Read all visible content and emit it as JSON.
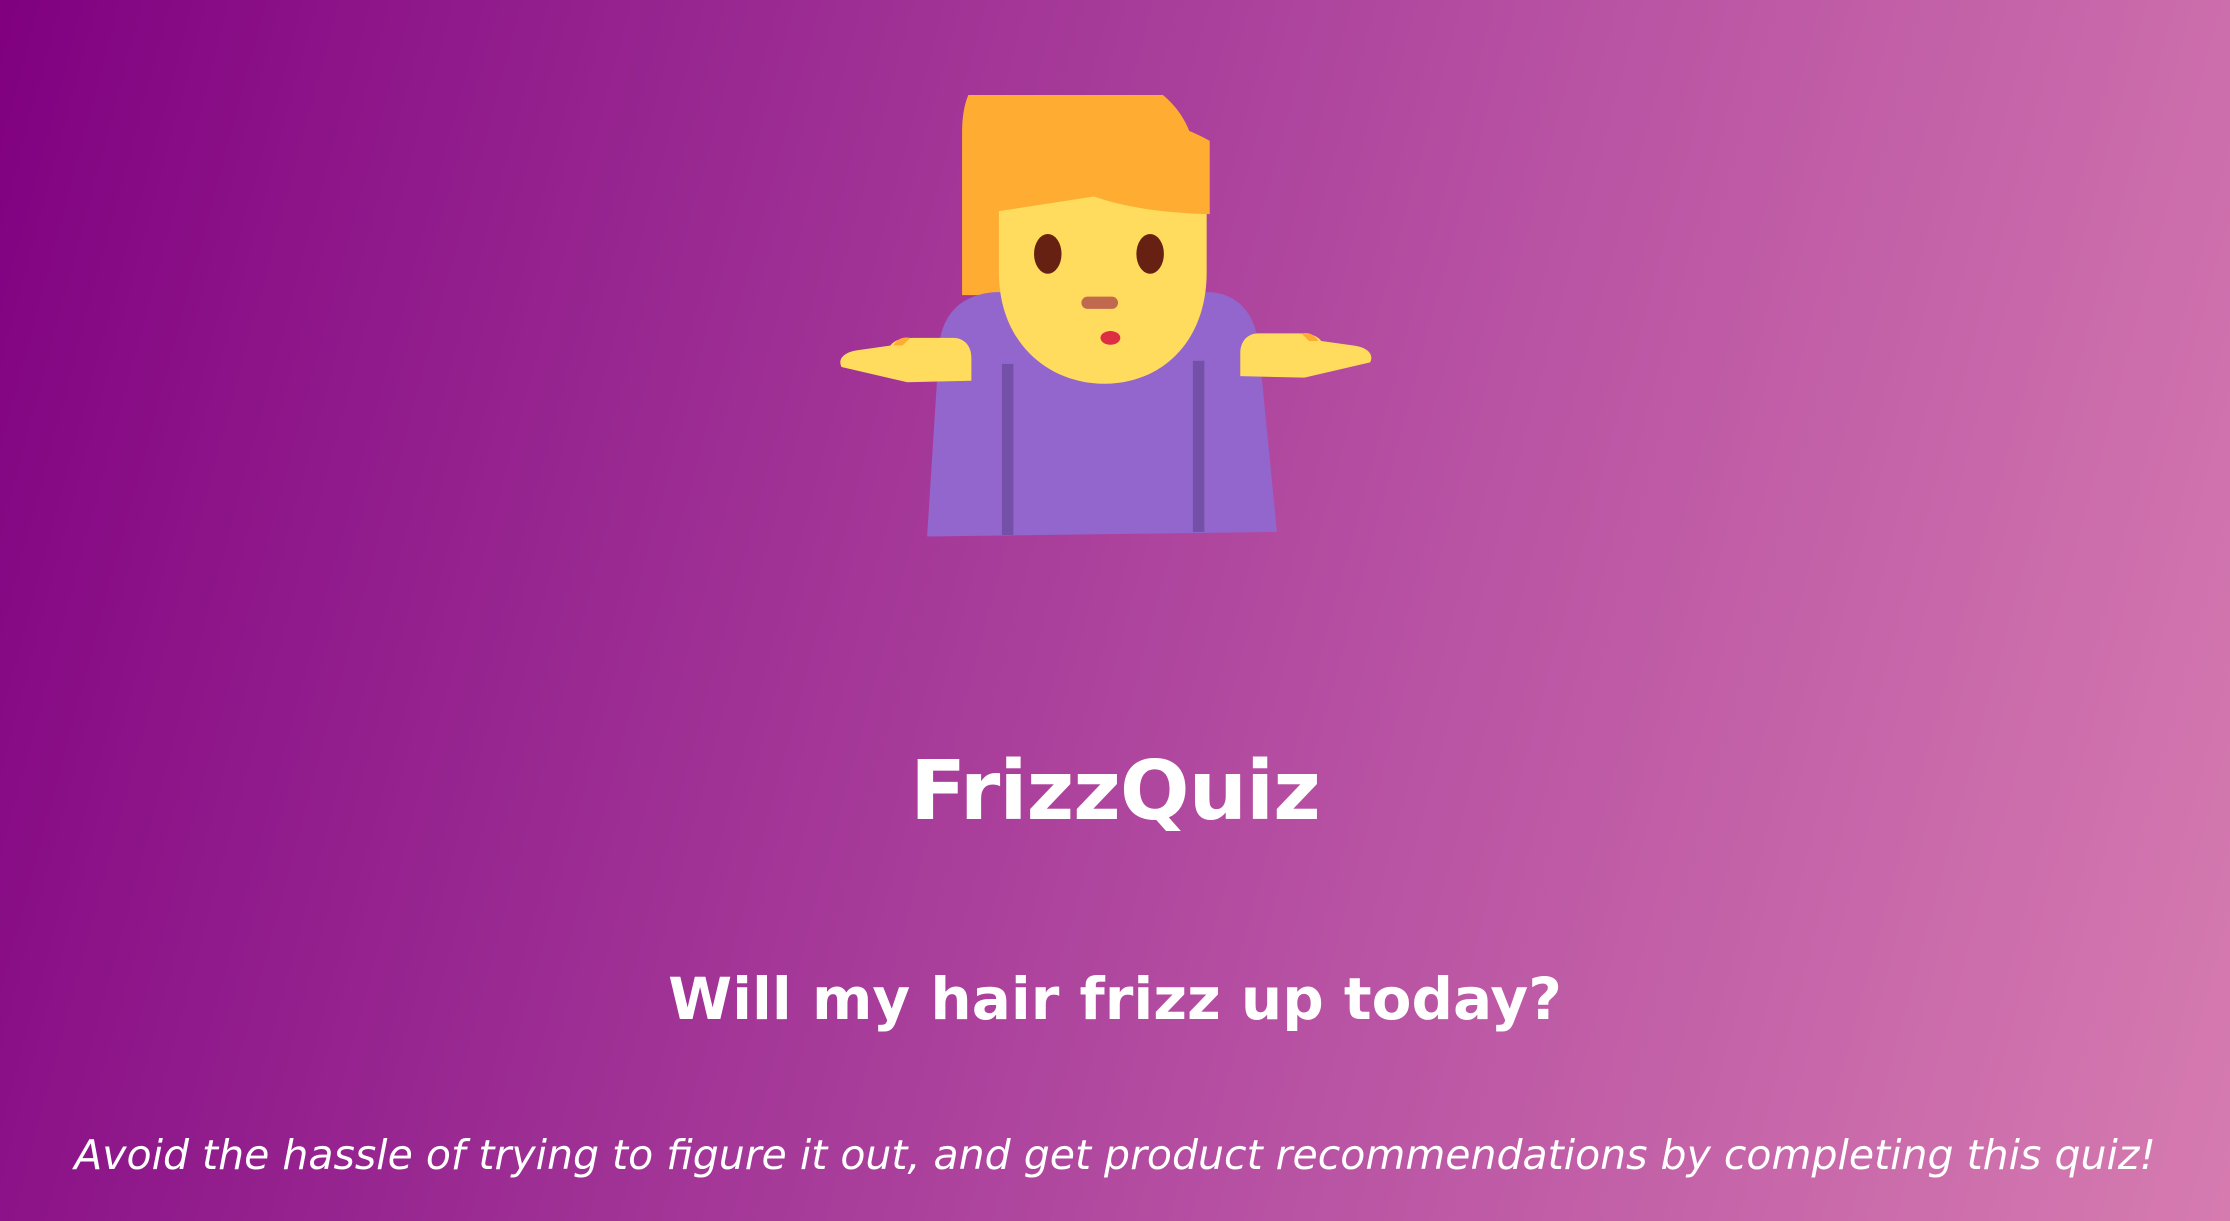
{
  "hero": {
    "icon": "woman-shrugging-icon"
  },
  "title": "FrizzQuiz",
  "headline": "Will my hair frizz up today?",
  "tagline": "Avoid the hassle of trying to figure it out, and get product recommendations by completing this quiz!",
  "colors": {
    "gradient_start": "#800080",
    "gradient_end": "#d67bb0",
    "text": "#ffffff",
    "hair": "#ffac33",
    "skin": "#ffdc5d",
    "shirt": "#9266cc",
    "shirt_shadow": "#7450a8",
    "eyes": "#662113",
    "nose": "#c1694f",
    "mouth": "#dd2e44"
  }
}
